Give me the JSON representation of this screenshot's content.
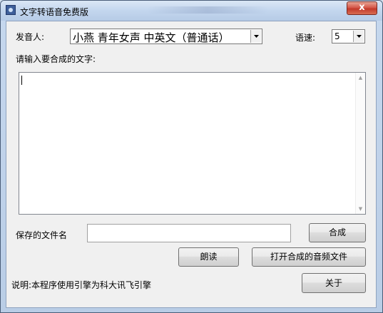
{
  "window": {
    "title": "文字转语音免费版",
    "close_glyph": "x"
  },
  "form": {
    "speaker_label": "发音人:",
    "speaker_value": "小燕 青年女声 中英文（普通话）",
    "speed_label": "语速:",
    "speed_value": "5",
    "text_label": "请输入要合成的文字:",
    "text_value": "",
    "filename_label": "保存的文件名",
    "filename_value": ""
  },
  "buttons": {
    "synthesize": "合成",
    "read": "朗读",
    "open_audio": "打开合成的音频文件",
    "about": "关于"
  },
  "footer": {
    "note": "说明:本程序使用引擎为科大讯飞引擎"
  },
  "icons": {
    "app": "app-icon",
    "dropdown": "chevron-down-icon",
    "scroll_up": "scroll-up-icon",
    "scroll_down": "scroll-down-icon"
  }
}
